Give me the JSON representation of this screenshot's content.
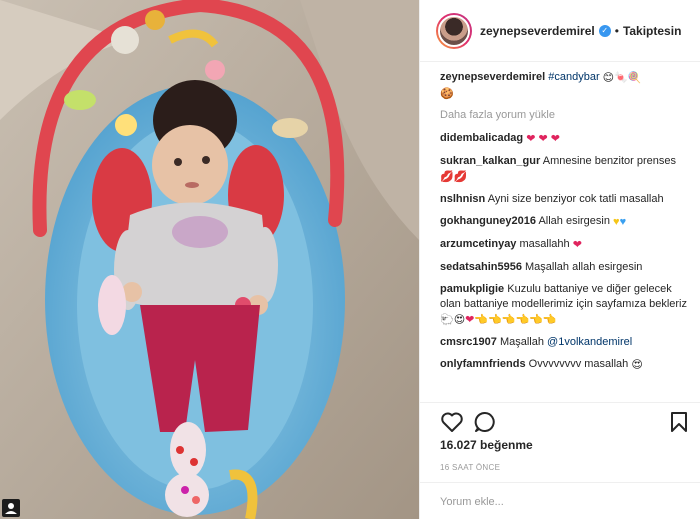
{
  "header": {
    "username": "zeynepseverdemirel",
    "separator": "•",
    "follow_label": "Takiptesin"
  },
  "caption": {
    "username": "zeynepseverdemirel",
    "hashtag": "#candybar"
  },
  "load_more": "Daha fazla yorum yükle",
  "comments": [
    {
      "user": "didembalicadag",
      "text": ""
    },
    {
      "user": "sukran_kalkan_gur",
      "text": "Amnesine benzitor prenses"
    },
    {
      "user": "nslhnisn",
      "text": "Ayni size benziyor cok tatli masallah"
    },
    {
      "user": "gokhanguney2016",
      "text": "Allah esirgesin"
    },
    {
      "user": "arzumcetinyay",
      "text": "masallahh"
    },
    {
      "user": "sedatsahin5956",
      "text": "Maşallah allah esirgesin"
    },
    {
      "user": "pamukpligie",
      "text": "Kuzulu battaniye ve diğer gelecek olan battaniye modellerimiz için sayfamıza bekleriz"
    },
    {
      "user": "cmsrc1907",
      "text": "Maşallah",
      "mention": "@1volkandemirel"
    },
    {
      "user": "onlyfamnfriends",
      "text": "Ovvvvvvvv masallah"
    }
  ],
  "likes": "16.027 beğenme",
  "timestamp": "16 SAAT ÖNCE",
  "comment_box": {
    "placeholder": "Yorum ekle..."
  },
  "colors": {
    "heart": "#e0245e",
    "verified": "#3897f0",
    "muted": "#999999"
  }
}
